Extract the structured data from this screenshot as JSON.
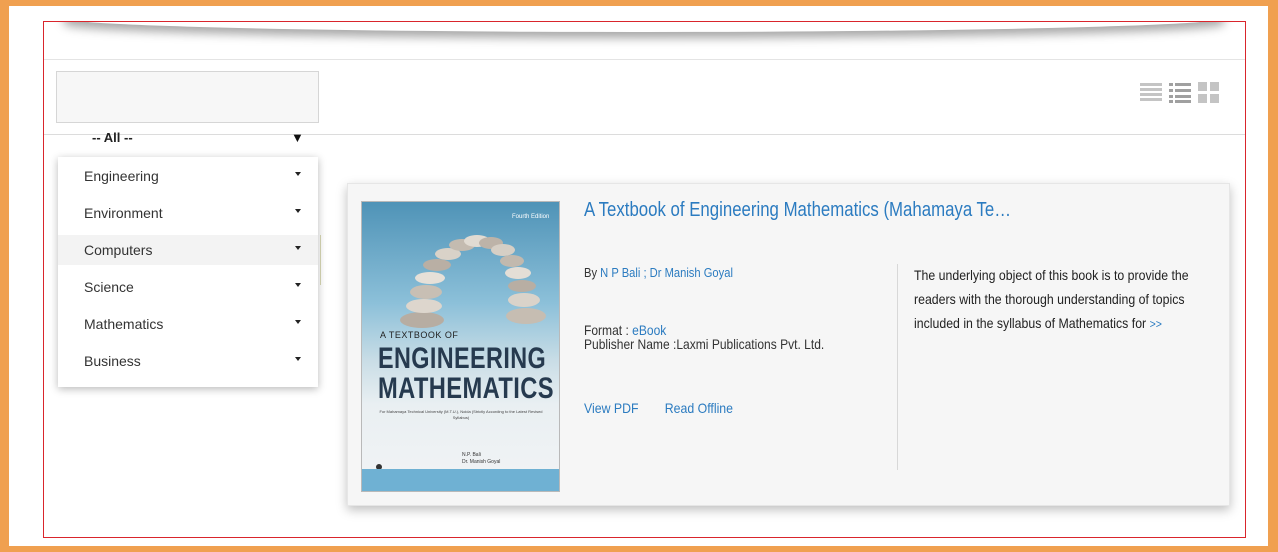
{
  "filter": {
    "search_placeholder": "",
    "selected": "-- All --",
    "categories": [
      {
        "label": "Engineering"
      },
      {
        "label": "Environment"
      },
      {
        "label": "Computers"
      },
      {
        "label": "Science"
      },
      {
        "label": "Mathematics"
      },
      {
        "label": "Business"
      }
    ]
  },
  "view_toggles": [
    "compact-list-icon",
    "detailed-list-icon",
    "grid-icon"
  ],
  "book": {
    "title": "A Textbook of Engineering Mathematics (Mahamaya Te…",
    "by_prefix": "By",
    "authors": "N P Bali ; Dr Manish Goyal",
    "format_label": "Format :",
    "format_value": "eBook",
    "publisher_label": "Publisher Name :",
    "publisher_value": "Laxmi Publications Pvt. Ltd.",
    "actions": {
      "view_pdf": "View PDF",
      "read_offline": "Read Offline"
    },
    "description": "The underlying object of this book is to provide the readers with the thorough understanding of topics included in the syllabus of Mathematics for",
    "more_link": ">>",
    "cover": {
      "edition": "Fourth Edition",
      "kicker": "A TEXTBOOK OF",
      "title_line1": "ENGINEERING",
      "title_line2": "MATHEMATICS",
      "fine_print": "For Mahamaya Technical University (M.T.U.), Noida (Strictly According to the Latest Revised Syllabus)",
      "author1": "N.P. Bali",
      "author2": "Dr. Manish Goyal"
    }
  },
  "colors": {
    "accent_link": "#2b7bc0",
    "outer_frame": "#f0a050",
    "inner_frame": "#d9252c"
  }
}
